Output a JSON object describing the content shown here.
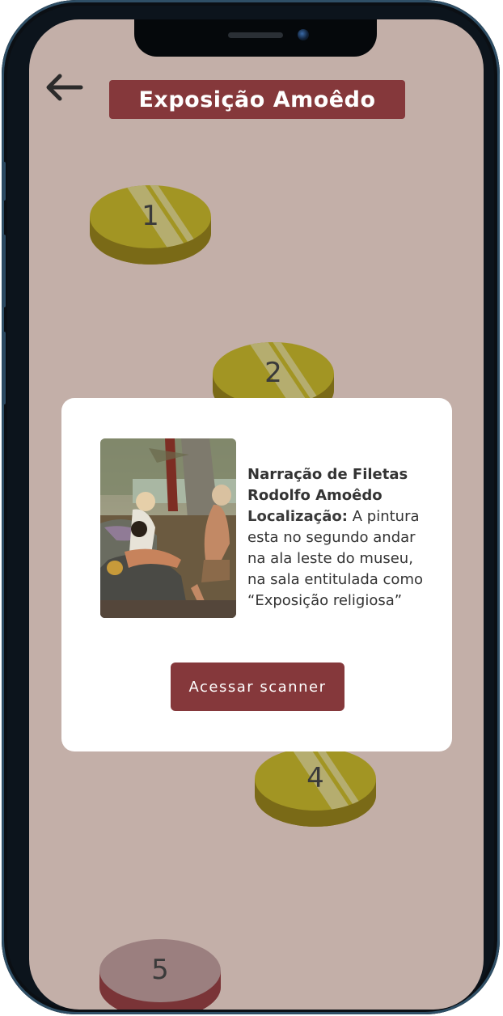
{
  "header": {
    "title": "Exposição Amoêdo",
    "back_icon": "arrow-left-icon"
  },
  "colors": {
    "screen_background": "#c3afa8",
    "accent": "#85383b",
    "coin_gold": "#9b8a1f",
    "coin_locked": "#9b7f7f"
  },
  "stations": [
    {
      "label": "1"
    },
    {
      "label": "2"
    },
    {
      "label": "4"
    },
    {
      "label": "5"
    }
  ],
  "modal": {
    "artwork_title_line1": "Narração de Filetas",
    "artwork_title_line2": "Rodolfo Amoêdo",
    "location_label": "Localização:",
    "location_text_1": "A pintura",
    "location_text_2": "esta no segundo andar",
    "location_text_3": "na ala leste do museu,",
    "location_text_4": "na sala entitulada como",
    "location_text_5": "“Exposição religiosa”",
    "button_label": "Acessar scanner"
  }
}
